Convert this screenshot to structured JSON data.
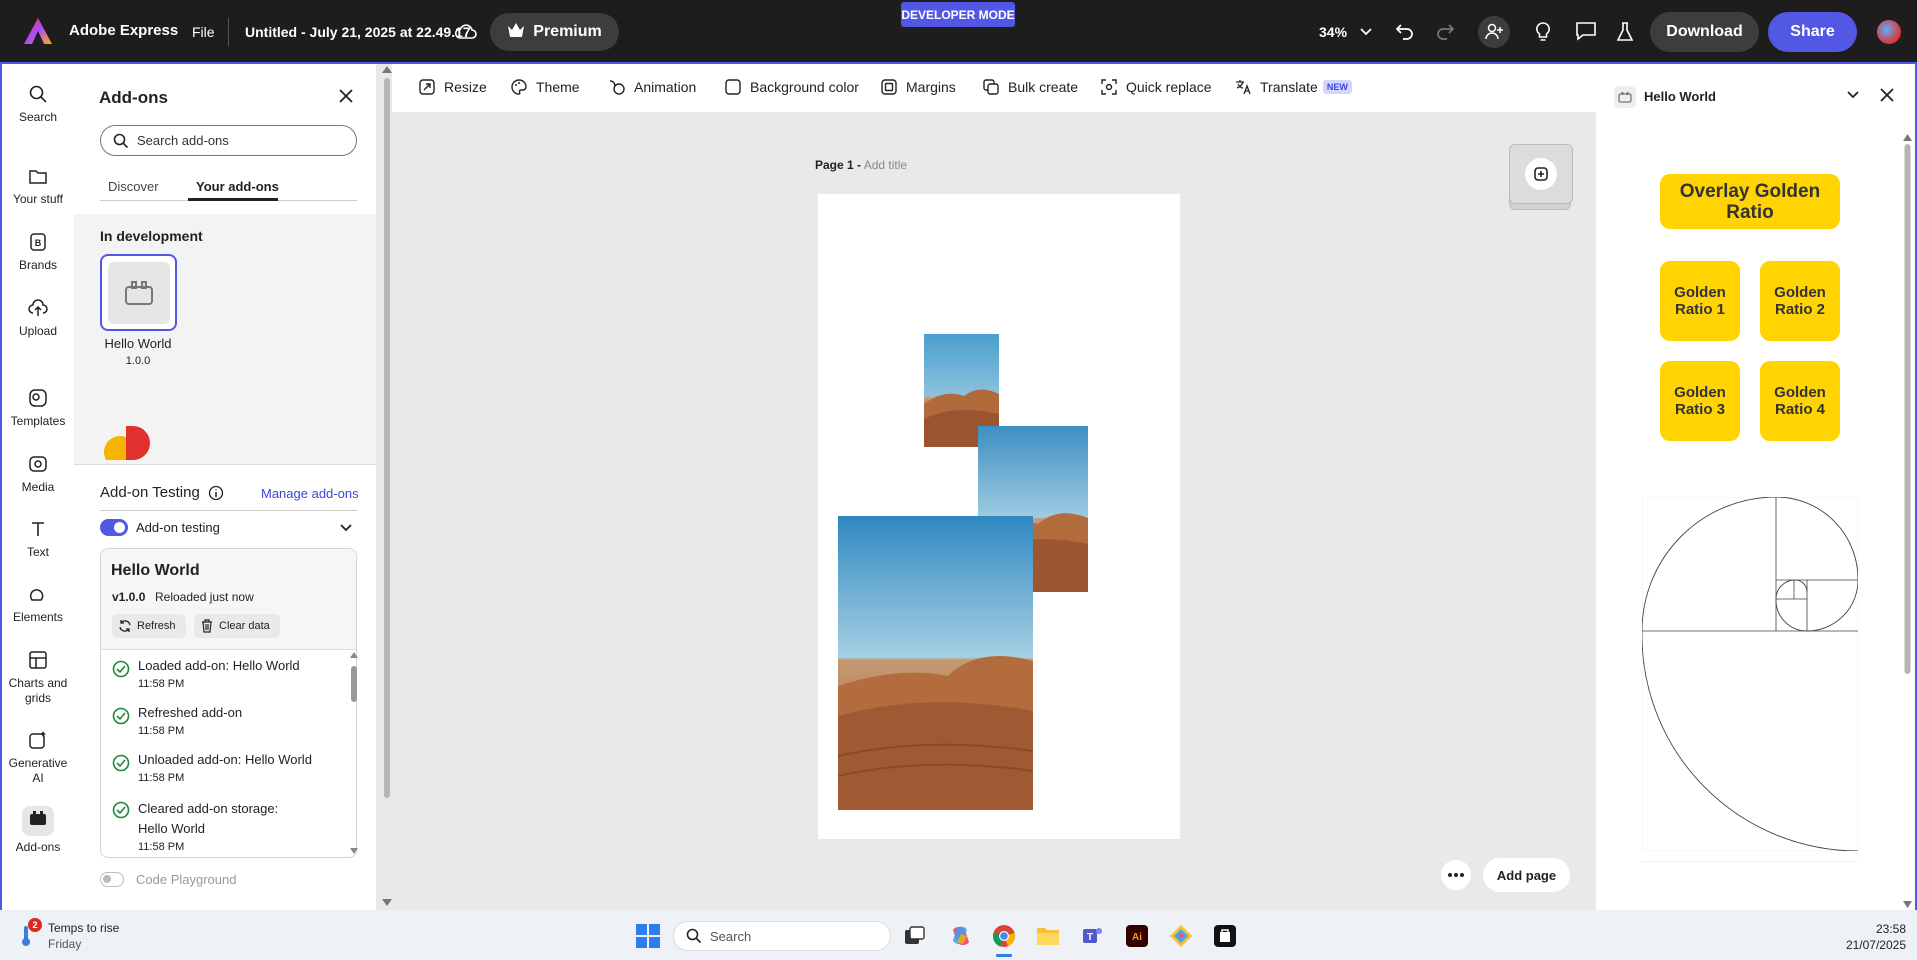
{
  "topbar": {
    "brand": "Adobe Express",
    "file_menu": "File",
    "doc_title": "Untitled - July 21, 2025 at 22.49.17",
    "premium": "Premium",
    "dev_mode": "DEVELOPER MODE",
    "zoom": "34%",
    "download": "Download",
    "share": "Share"
  },
  "rail": {
    "items": [
      "Search",
      "Your stuff",
      "Brands",
      "Upload",
      "Templates",
      "Media",
      "Text",
      "Elements",
      "Charts and grids",
      "Generative AI",
      "Add-ons"
    ]
  },
  "addons_panel": {
    "title": "Add-ons",
    "search_placeholder": "Search add-ons",
    "tabs": [
      "Discover",
      "Your add-ons"
    ],
    "in_development": "In development",
    "addon_name": "Hello World",
    "addon_version": "1.0.0",
    "testing_title": "Add-on Testing",
    "manage_link": "Manage add-ons",
    "testing_toggle_label": "Add-on testing",
    "card_title": "Hello World",
    "card_version": "v1.0.0",
    "card_status": "Reloaded just now",
    "refresh": "Refresh",
    "clear_data": "Clear data",
    "logs": [
      {
        "msg": "Loaded add-on: Hello World",
        "time": "11:58 PM"
      },
      {
        "msg": "Refreshed add-on",
        "time": "11:58 PM"
      },
      {
        "msg": "Unloaded add-on: Hello World",
        "time": "11:58 PM"
      },
      {
        "msg": "Cleared add-on storage: Hello World",
        "time": "11:58 PM"
      }
    ],
    "playground": "Code Playground"
  },
  "toolbar": {
    "tools": [
      "Resize",
      "Theme",
      "Animation",
      "Background color",
      "Margins",
      "Bulk create",
      "Quick replace",
      "Translate"
    ],
    "new_badge": "NEW"
  },
  "canvas": {
    "page_label": "Page 1 -",
    "add_title": "Add title",
    "add_page": "Add page"
  },
  "right_panel": {
    "title": "Hello World",
    "overlay_btn": "Overlay Golden Ratio",
    "ratio_btns": [
      "Golden Ratio 1",
      "Golden Ratio 2",
      "Golden Ratio 3",
      "Golden Ratio 4"
    ]
  },
  "taskbar": {
    "weather_title": "Temps to rise",
    "weather_sub": "Friday",
    "weather_badge": "2",
    "search": "Search",
    "time": "23:58",
    "date": "21/07/2025"
  },
  "colors": {
    "accent": "#5258e4",
    "golden": "#ffd400",
    "topbar": "#1d1d1d"
  }
}
